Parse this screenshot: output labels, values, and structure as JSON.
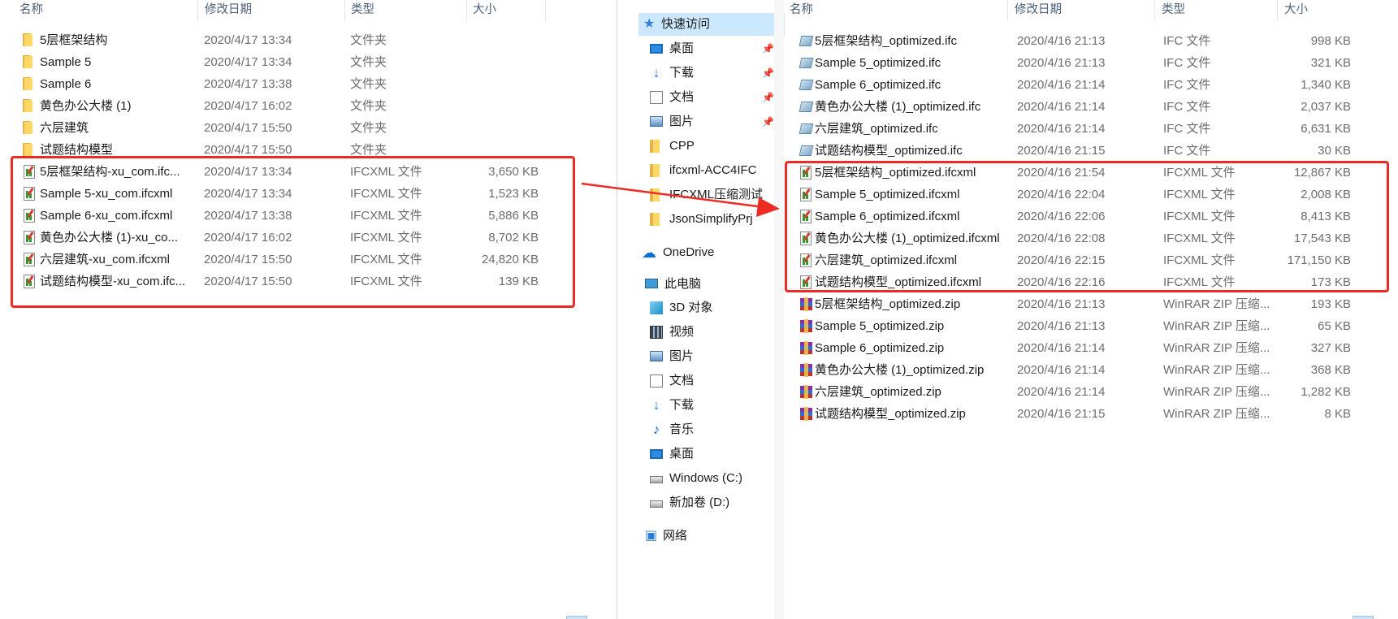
{
  "left_pane": {
    "columns": {
      "name": "名称",
      "date": "修改日期",
      "type": "类型",
      "size": "大小"
    },
    "rows": [
      {
        "icon": "folder-icon",
        "name": "5层框架结构",
        "date": "2020/4/17 13:34",
        "type": "文件夹",
        "size": ""
      },
      {
        "icon": "folder-icon",
        "name": "Sample 5",
        "date": "2020/4/17 13:34",
        "type": "文件夹",
        "size": ""
      },
      {
        "icon": "folder-icon",
        "name": "Sample 6",
        "date": "2020/4/17 13:38",
        "type": "文件夹",
        "size": ""
      },
      {
        "icon": "folder-icon",
        "name": "黄色办公大楼 (1)",
        "date": "2020/4/17 16:02",
        "type": "文件夹",
        "size": ""
      },
      {
        "icon": "folder-icon",
        "name": "六层建筑",
        "date": "2020/4/17 15:50",
        "type": "文件夹",
        "size": ""
      },
      {
        "icon": "folder-icon",
        "name": "试题结构模型",
        "date": "2020/4/17 15:50",
        "type": "文件夹",
        "size": ""
      },
      {
        "icon": "xml-file-icon",
        "name": "5层框架结构-xu_com.ifc...",
        "date": "2020/4/17 13:34",
        "type": "IFCXML 文件",
        "size": "3,650 KB"
      },
      {
        "icon": "xml-file-icon",
        "name": "Sample 5-xu_com.ifcxml",
        "date": "2020/4/17 13:34",
        "type": "IFCXML 文件",
        "size": "1,523 KB"
      },
      {
        "icon": "xml-file-icon",
        "name": "Sample 6-xu_com.ifcxml",
        "date": "2020/4/17 13:38",
        "type": "IFCXML 文件",
        "size": "5,886 KB"
      },
      {
        "icon": "xml-file-icon",
        "name": "黄色办公大楼 (1)-xu_co...",
        "date": "2020/4/17 16:02",
        "type": "IFCXML 文件",
        "size": "8,702 KB"
      },
      {
        "icon": "xml-file-icon",
        "name": "六层建筑-xu_com.ifcxml",
        "date": "2020/4/17 15:50",
        "type": "IFCXML 文件",
        "size": "24,820 KB"
      },
      {
        "icon": "xml-file-icon",
        "name": "试题结构模型-xu_com.ifc...",
        "date": "2020/4/17 15:50",
        "type": "IFCXML 文件",
        "size": "139 KB"
      }
    ]
  },
  "nav": {
    "quick_access": "快速访问",
    "items": [
      {
        "icon": "desktop-icon",
        "label": "桌面",
        "pinned": true
      },
      {
        "icon": "download-icon",
        "label": "下载",
        "pinned": true
      },
      {
        "icon": "document-icon",
        "label": "文档",
        "pinned": true
      },
      {
        "icon": "picture-icon",
        "label": "图片",
        "pinned": true
      },
      {
        "icon": "folder-icon",
        "label": "CPP",
        "pinned": false
      },
      {
        "icon": "folder-icon",
        "label": "ifcxml-ACC4IFC",
        "pinned": false
      },
      {
        "icon": "folder-icon",
        "label": "IFCXML压缩测试",
        "pinned": false
      },
      {
        "icon": "folder-icon",
        "label": "JsonSimplifyPrj",
        "pinned": false
      }
    ],
    "onedrive": "OneDrive",
    "this_pc": "此电脑",
    "pc_items": [
      {
        "icon": "3d-objects-icon",
        "label": "3D 对象"
      },
      {
        "icon": "video-icon",
        "label": "视频"
      },
      {
        "icon": "picture-icon",
        "label": "图片"
      },
      {
        "icon": "document-icon",
        "label": "文档"
      },
      {
        "icon": "download-icon",
        "label": "下载"
      },
      {
        "icon": "music-icon",
        "label": "音乐"
      },
      {
        "icon": "desktop-icon",
        "label": "桌面"
      },
      {
        "icon": "drive-c-icon",
        "label": "Windows (C:)"
      },
      {
        "icon": "drive-d-icon",
        "label": "新加卷 (D:)"
      }
    ],
    "network": "网络",
    "pin_glyph": "📌"
  },
  "right_pane": {
    "columns": {
      "name": "名称",
      "date": "修改日期",
      "type": "类型",
      "size": "大小"
    },
    "rows": [
      {
        "icon": "ifc-file-icon",
        "name": "5层框架结构_optimized.ifc",
        "date": "2020/4/16 21:13",
        "type": "IFC 文件",
        "size": "998 KB"
      },
      {
        "icon": "ifc-file-icon",
        "name": "Sample 5_optimized.ifc",
        "date": "2020/4/16 21:13",
        "type": "IFC 文件",
        "size": "321 KB"
      },
      {
        "icon": "ifc-file-icon",
        "name": "Sample 6_optimized.ifc",
        "date": "2020/4/16 21:14",
        "type": "IFC 文件",
        "size": "1,340 KB"
      },
      {
        "icon": "ifc-file-icon",
        "name": "黄色办公大楼 (1)_optimized.ifc",
        "date": "2020/4/16 21:14",
        "type": "IFC 文件",
        "size": "2,037 KB"
      },
      {
        "icon": "ifc-file-icon",
        "name": "六层建筑_optimized.ifc",
        "date": "2020/4/16 21:14",
        "type": "IFC 文件",
        "size": "6,631 KB"
      },
      {
        "icon": "ifc-file-icon",
        "name": "试题结构模型_optimized.ifc",
        "date": "2020/4/16 21:15",
        "type": "IFC 文件",
        "size": "30 KB"
      },
      {
        "icon": "xml-file-icon",
        "name": "5层框架结构_optimized.ifcxml",
        "date": "2020/4/16 21:54",
        "type": "IFCXML 文件",
        "size": "12,867 KB"
      },
      {
        "icon": "xml-file-icon",
        "name": "Sample 5_optimized.ifcxml",
        "date": "2020/4/16 22:04",
        "type": "IFCXML 文件",
        "size": "2,008 KB"
      },
      {
        "icon": "xml-file-icon",
        "name": "Sample 6_optimized.ifcxml",
        "date": "2020/4/16 22:06",
        "type": "IFCXML 文件",
        "size": "8,413 KB"
      },
      {
        "icon": "xml-file-icon",
        "name": "黄色办公大楼 (1)_optimized.ifcxml",
        "date": "2020/4/16 22:08",
        "type": "IFCXML 文件",
        "size": "17,543 KB"
      },
      {
        "icon": "xml-file-icon",
        "name": "六层建筑_optimized.ifcxml",
        "date": "2020/4/16 22:15",
        "type": "IFCXML 文件",
        "size": "171,150 KB"
      },
      {
        "icon": "xml-file-icon",
        "name": "试题结构模型_optimized.ifcxml",
        "date": "2020/4/16 22:16",
        "type": "IFCXML 文件",
        "size": "173 KB"
      },
      {
        "icon": "winrar-zip-icon",
        "name": "5层框架结构_optimized.zip",
        "date": "2020/4/16 21:13",
        "type": "WinRAR ZIP 压缩...",
        "size": "193 KB"
      },
      {
        "icon": "winrar-zip-icon",
        "name": "Sample 5_optimized.zip",
        "date": "2020/4/16 21:13",
        "type": "WinRAR ZIP 压缩...",
        "size": "65 KB"
      },
      {
        "icon": "winrar-zip-icon",
        "name": "Sample 6_optimized.zip",
        "date": "2020/4/16 21:14",
        "type": "WinRAR ZIP 压缩...",
        "size": "327 KB"
      },
      {
        "icon": "winrar-zip-icon",
        "name": "黄色办公大楼 (1)_optimized.zip",
        "date": "2020/4/16 21:14",
        "type": "WinRAR ZIP 压缩...",
        "size": "368 KB"
      },
      {
        "icon": "winrar-zip-icon",
        "name": "六层建筑_optimized.zip",
        "date": "2020/4/16 21:14",
        "type": "WinRAR ZIP 压缩...",
        "size": "1,282 KB"
      },
      {
        "icon": "winrar-zip-icon",
        "name": "试题结构模型_optimized.zip",
        "date": "2020/4/16 21:15",
        "type": "WinRAR ZIP 压缩...",
        "size": "8 KB"
      }
    ]
  },
  "colors": {
    "highlight": "#ee2a24",
    "selected": "#cce8ff",
    "header_text": "#4c607a"
  }
}
